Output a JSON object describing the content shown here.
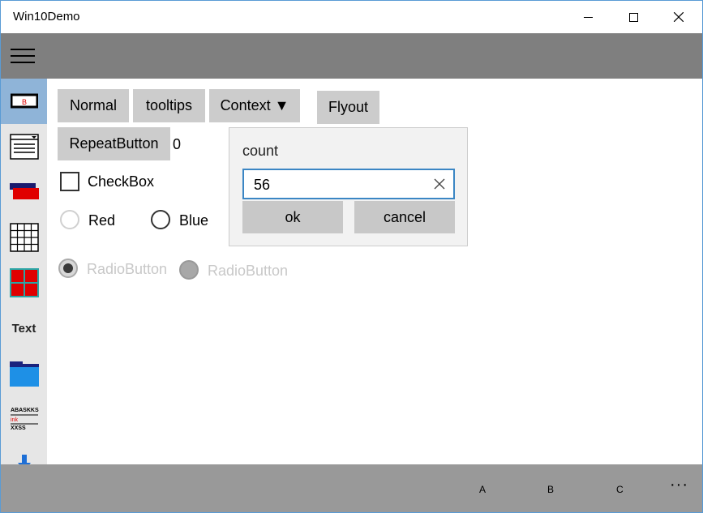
{
  "window": {
    "title": "Win10Demo"
  },
  "nav": {
    "items": [
      {
        "icon": "button-icon"
      },
      {
        "icon": "window-form-icon"
      },
      {
        "icon": "stacked-layers-icon"
      },
      {
        "icon": "grid-table-icon"
      },
      {
        "icon": "tiles-icon"
      },
      {
        "icon": "text-icon",
        "text": "Text"
      },
      {
        "icon": "folder-icon"
      },
      {
        "icon": "list-text-icon",
        "lines": [
          "ABASKKS",
          "ink",
          "XXSS"
        ]
      },
      {
        "icon": "download-icon"
      }
    ]
  },
  "content": {
    "buttons": {
      "normal": "Normal",
      "tooltips": "tooltips",
      "context": "Context ▼",
      "flyout": "Flyout",
      "repeat": "RepeatButton"
    },
    "repeat_count": "0",
    "checkbox_label": "CheckBox",
    "radio_red": "Red",
    "radio_blue": "Blue",
    "radio_disabled_1": "RadioButton",
    "radio_disabled_2": "RadioButton"
  },
  "flyout": {
    "title": "count",
    "input_value": "56",
    "ok": "ok",
    "cancel": "cancel"
  },
  "commandbar": {
    "a": "A",
    "b": "B",
    "c": "C",
    "more": "···"
  },
  "colors": {
    "header": "#7f7f7f",
    "nav_selected": "#8fb4d8",
    "accent": "#3b86c4",
    "commandbar": "#999999"
  }
}
